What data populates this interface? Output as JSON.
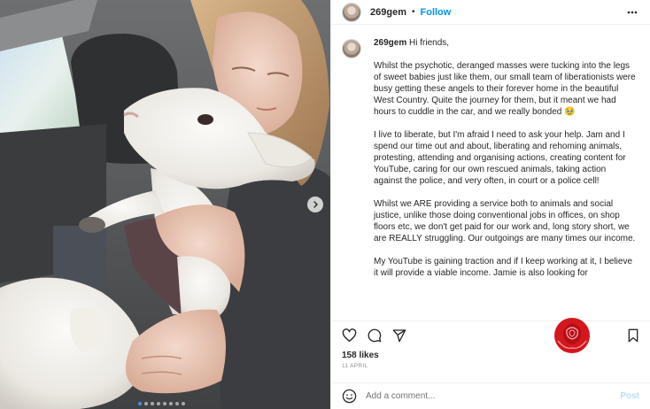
{
  "header": {
    "username": "269gem",
    "separator": "•",
    "follow_label": "Follow"
  },
  "caption": {
    "username": "269gem",
    "greeting": "Hi friends,",
    "paragraphs": [
      "Whilst the psychotic, deranged masses were tucking into the legs of sweet babies just like them, our small team of liberationists were busy getting these angels to their forever home in the beautiful West Country. Quite the journey for them, but it meant we had hours to cuddle in the car, and we really bonded 🥹",
      "I live to liberate, but I'm afraid I need to ask your help. Jam and I spend our time out and about, liberating and rehoming animals, protesting, attending and organising actions, creating content for YouTube, caring for our own rescued animals, taking action against the police, and very often, in court or a police cell!",
      "Whilst we ARE providing a service both to animals and social justice, unlike those doing conventional jobs in offices, on shop floors etc, we don't get paid for our work and, long story short, we are REALLY struggling. Our outgoings are many times our income.",
      "My YouTube is gaining traction and if I keep working at it, I believe it will provide a viable income. Jamie is also looking for"
    ]
  },
  "engagement": {
    "likes": "158 likes",
    "date": "11 APRIL"
  },
  "comment_box": {
    "placeholder": "Add a comment...",
    "post_label": "Post"
  },
  "carousel": {
    "dot_count": 8,
    "active_index": 0
  },
  "icons": {
    "more": "more-options-icon",
    "like": "heart-icon",
    "comment": "comment-icon",
    "share": "share-icon",
    "save": "bookmark-icon",
    "emoji": "emoji-icon",
    "next": "chevron-right-icon",
    "overlay": "rose-icon"
  },
  "colors": {
    "follow": "#0095f6",
    "post_disabled": "#b2dffc",
    "rose": "#d6161d",
    "carousel_active_dot": "#4a90e2"
  }
}
